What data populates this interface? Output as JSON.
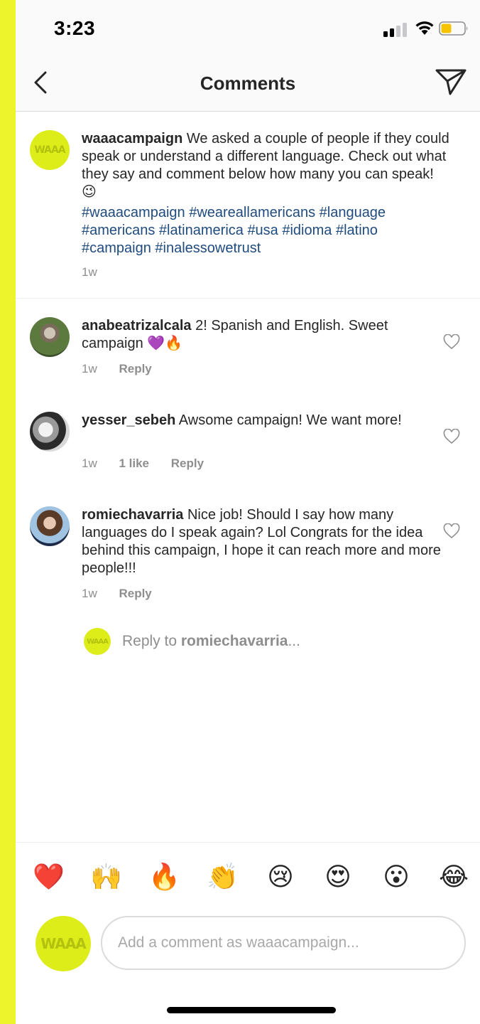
{
  "status": {
    "time": "3:23"
  },
  "header": {
    "title": "Comments"
  },
  "post": {
    "username": "waaacampaign",
    "text": "We asked a couple of people if they could speak or understand a different language. Check out what they say and comment below how many you can speak! 😉",
    "hashtags": "#waaacampaign #weareallamericans #language #americans #latinamerica #usa #idioma #latino #campaign #inalessowetrust",
    "time": "1w",
    "avatar_label": "WAAA"
  },
  "comments": [
    {
      "username": "anabeatrizalcala",
      "text": "2! Spanish and English. Sweet campaign 💜🔥",
      "time": "1w",
      "likes": "",
      "reply": "Reply"
    },
    {
      "username": "yesser_sebeh",
      "text": "Awsome campaign! We want more!",
      "time": "1w",
      "likes": "1 like",
      "reply": "Reply"
    },
    {
      "username": "romiechavarria",
      "text": "Nice job! Should I say how many languages do I speak again? Lol Congrats for the idea behind this campaign, I hope it can reach more and more people!!!",
      "time": "1w",
      "likes": "",
      "reply": "Reply"
    }
  ],
  "reply_prompt": {
    "prefix": "Reply to ",
    "username": "romiechavarria",
    "suffix": "..."
  },
  "emoji_bar": [
    "❤️",
    "🙌",
    "🔥",
    "👏",
    "😢",
    "😍",
    "😮",
    "😂"
  ],
  "composer": {
    "placeholder": "Add a comment as waaacampaign..."
  },
  "colors": {
    "accent_strip": "#eef42b",
    "hashtag": "#1f4b7f",
    "waaa_badge": "#dced1a"
  }
}
